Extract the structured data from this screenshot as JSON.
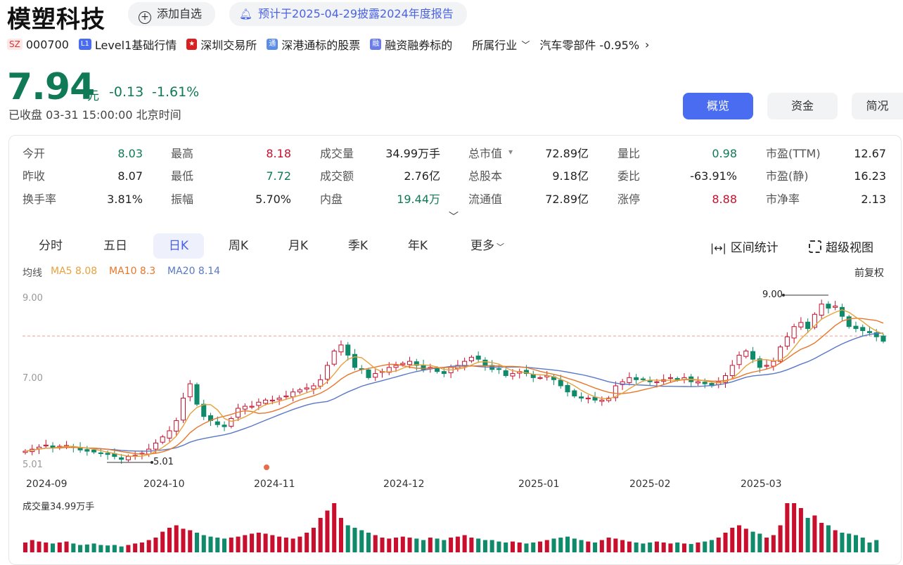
{
  "header": {
    "name": "模塑科技",
    "add_watch": "添加自选",
    "notice": "预计于2025-04-29披露2024年度报告"
  },
  "tags": {
    "exchange_code": "SZ",
    "code": "000700",
    "level1_icon": "L1",
    "level1": "Level1基础行情",
    "market": "深圳交易所",
    "connect_icon": "通",
    "connect": "深港通标的股票",
    "margin_icon": "融",
    "margin": "融资融券标的",
    "industry_label": "所属行业",
    "industry": "汽车零部件 -0.95%"
  },
  "quote": {
    "price": "7.94",
    "unit": "元",
    "change": "-0.13",
    "change_pct": "-1.61%",
    "status": "已收盘 03-31 15:00:00 北京时间"
  },
  "nav": [
    "概览",
    "资金",
    "简况"
  ],
  "stats": [
    [
      {
        "label": "今开",
        "value": "8.03",
        "color": "green"
      },
      {
        "label": "最高",
        "value": "8.18",
        "color": "red"
      },
      {
        "label": "成交量",
        "value": "34.99万手",
        "color": ""
      },
      {
        "label": "总市值",
        "value": "72.89亿",
        "color": ""
      },
      {
        "label": "量比",
        "value": "0.98",
        "color": "green"
      },
      {
        "label": "市盈(TTM)",
        "value": "12.67",
        "color": ""
      }
    ],
    [
      {
        "label": "昨收",
        "value": "8.07",
        "color": ""
      },
      {
        "label": "最低",
        "value": "7.72",
        "color": "green"
      },
      {
        "label": "成交额",
        "value": "2.76亿",
        "color": ""
      },
      {
        "label": "总股本",
        "value": "9.18亿",
        "color": ""
      },
      {
        "label": "委比",
        "value": "-63.91%",
        "color": ""
      },
      {
        "label": "市盈(静)",
        "value": "16.23",
        "color": ""
      }
    ],
    [
      {
        "label": "换手率",
        "value": "3.81%",
        "color": ""
      },
      {
        "label": "振幅",
        "value": "5.70%",
        "color": ""
      },
      {
        "label": "内盘",
        "value": "19.44万",
        "color": "green"
      },
      {
        "label": "流通值",
        "value": "72.89亿",
        "color": ""
      },
      {
        "label": "涨停",
        "value": "8.88",
        "color": "red"
      },
      {
        "label": "市净率",
        "value": "2.13",
        "color": ""
      }
    ]
  ],
  "tabs": [
    "分时",
    "五日",
    "日K",
    "周K",
    "月K",
    "季K",
    "年K",
    "更多"
  ],
  "tools": {
    "range": "区间统计",
    "super": "超级视图",
    "adjust": "前复权"
  },
  "ma": {
    "label": "均线",
    "ma5": "MA5 8.08",
    "ma10": "MA10 8.3",
    "ma20": "MA20 8.14"
  },
  "colors": {
    "up": "#c8102e",
    "down": "#0f8a6a",
    "ma5": "#e8a13c",
    "ma10": "#e8772b",
    "ma20": "#5a78c8",
    "accent": "#4a6cf0"
  },
  "chart_data": {
    "type": "candlestick",
    "y_ticks": [
      "9.00",
      "7.00",
      "5.01"
    ],
    "y_range": [
      5.01,
      9.0
    ],
    "annotations": {
      "high": "9.00",
      "low": "5.01"
    },
    "x_labels": [
      "2024-09",
      "2024-10",
      "2024-11",
      "2024-12",
      "2025-01",
      "2025-02",
      "2025-03"
    ],
    "volume_label": "成交量34.99万手",
    "closes": [
      5.25,
      5.3,
      5.35,
      5.4,
      5.33,
      5.37,
      5.39,
      5.35,
      5.28,
      5.25,
      5.23,
      5.2,
      5.17,
      5.12,
      5.05,
      5.12,
      5.15,
      5.2,
      5.3,
      5.45,
      5.6,
      5.75,
      6.0,
      6.55,
      6.9,
      6.4,
      6.1,
      6.0,
      5.9,
      5.85,
      6.05,
      6.3,
      6.35,
      6.35,
      6.45,
      6.5,
      6.5,
      6.55,
      6.6,
      6.7,
      6.75,
      6.8,
      6.85,
      7.0,
      7.35,
      7.7,
      7.85,
      7.6,
      7.3,
      7.25,
      7.05,
      7.15,
      7.2,
      7.3,
      7.35,
      7.4,
      7.45,
      7.35,
      7.25,
      7.3,
      7.2,
      7.15,
      7.3,
      7.35,
      7.45,
      7.55,
      7.5,
      7.35,
      7.25,
      7.25,
      7.1,
      7.15,
      7.2,
      7.15,
      7.05,
      7.05,
      7.1,
      7.0,
      6.85,
      6.7,
      6.6,
      6.55,
      6.55,
      6.5,
      6.5,
      6.55,
      6.85,
      6.95,
      7.05,
      7.0,
      7.0,
      6.95,
      6.95,
      7.0,
      7.05,
      7.0,
      7.05,
      6.95,
      6.95,
      6.9,
      6.85,
      6.95,
      7.1,
      7.35,
      7.6,
      7.7,
      7.5,
      7.3,
      7.35,
      7.45,
      7.8,
      8.05,
      8.3,
      8.4,
      8.25,
      8.6,
      8.85,
      8.75,
      8.8,
      8.55,
      8.3,
      8.25,
      8.2,
      8.15,
      8.05,
      7.94
    ],
    "volumes": [
      0.2,
      0.25,
      0.22,
      0.2,
      0.18,
      0.2,
      0.22,
      0.18,
      0.15,
      0.16,
      0.18,
      0.15,
      0.14,
      0.15,
      0.12,
      0.15,
      0.18,
      0.2,
      0.25,
      0.3,
      0.42,
      0.5,
      0.55,
      0.48,
      0.45,
      0.4,
      0.35,
      0.32,
      0.3,
      0.28,
      0.3,
      0.32,
      0.35,
      0.38,
      0.4,
      0.38,
      0.35,
      0.32,
      0.3,
      0.28,
      0.32,
      0.4,
      0.5,
      0.7,
      0.85,
      1.0,
      0.7,
      0.55,
      0.5,
      0.45,
      0.4,
      0.35,
      0.3,
      0.28,
      0.3,
      0.32,
      0.3,
      0.28,
      0.25,
      0.3,
      0.28,
      0.25,
      0.3,
      0.32,
      0.35,
      0.3,
      0.28,
      0.25,
      0.25,
      0.22,
      0.2,
      0.22,
      0.2,
      0.18,
      0.2,
      0.22,
      0.25,
      0.28,
      0.3,
      0.32,
      0.28,
      0.25,
      0.22,
      0.2,
      0.25,
      0.3,
      0.28,
      0.25,
      0.22,
      0.2,
      0.18,
      0.2,
      0.22,
      0.2,
      0.18,
      0.2,
      0.18,
      0.17,
      0.2,
      0.22,
      0.25,
      0.3,
      0.4,
      0.5,
      0.55,
      0.48,
      0.42,
      0.38,
      0.3,
      0.35,
      0.55,
      1.0,
      1.0,
      0.9,
      0.7,
      0.75,
      0.6,
      0.55,
      0.45,
      0.4,
      0.38,
      0.35,
      0.3,
      0.2,
      0.25
    ]
  }
}
